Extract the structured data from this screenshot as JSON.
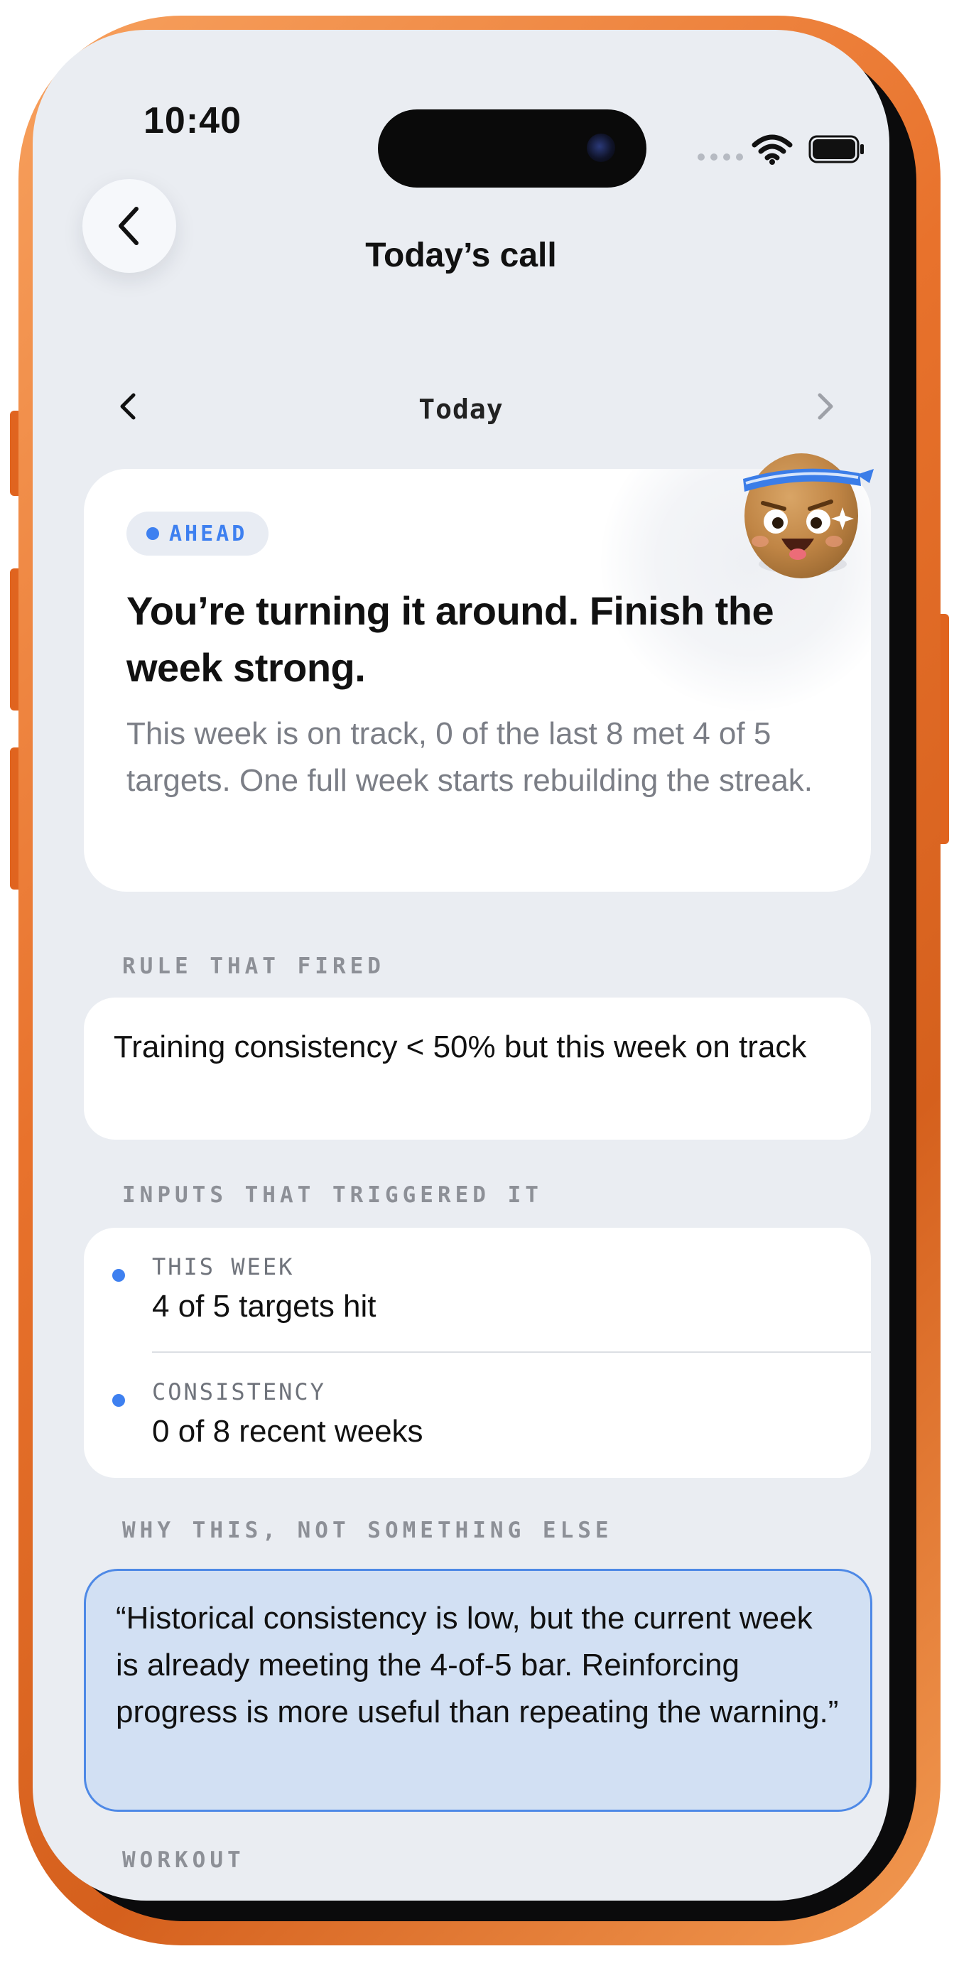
{
  "status_bar": {
    "time": "10:40"
  },
  "header": {
    "title": "Today’s call"
  },
  "date_nav": {
    "label": "Today"
  },
  "hero": {
    "badge": "AHEAD",
    "headline": "You’re turning it around. Finish the week strong.",
    "body": "This week is on track, 0 of the last 8 met 4 of 5 targets. One full week starts rebuilding the streak."
  },
  "rule_section": {
    "label": "RULE THAT FIRED",
    "text": "Training consistency < 50% but this week on track"
  },
  "inputs_section": {
    "label": "INPUTS THAT TRIGGERED IT",
    "items": [
      {
        "label": "THIS WEEK",
        "value": "4 of 5 targets hit"
      },
      {
        "label": "CONSISTENCY",
        "value": "0 of 8 recent weeks"
      }
    ]
  },
  "why_section": {
    "label": "WHY THIS, NOT SOMETHING ELSE",
    "quote": "“Historical consistency is low, but the current week is already meeting the 4-of-5 bar. Reinforcing progress is more useful than repeating the warning.”"
  },
  "workout_section": {
    "label": "WORKOUT"
  },
  "colors": {
    "accent": "#3e80f0",
    "frame": "#e8722c",
    "screen_bg": "#eaedf2",
    "quote_bg": "#d2e0f3"
  }
}
